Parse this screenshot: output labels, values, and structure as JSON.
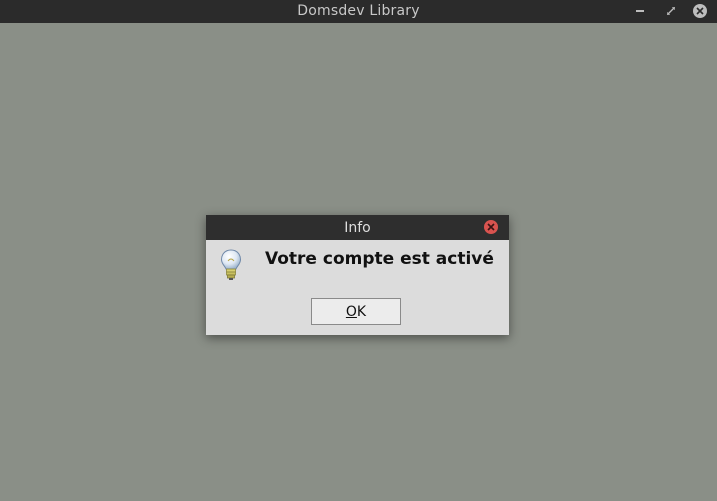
{
  "window": {
    "title": "Domsdev Library",
    "controls": {
      "minimize_icon": "minimize-icon",
      "maximize_icon": "maximize-icon",
      "close_icon": "close-icon"
    },
    "background_color": "#8a8f87"
  },
  "dialog": {
    "title": "Info",
    "icon": "lightbulb-icon",
    "message": "Votre compte est activé",
    "ok_button": {
      "mnemonic": "O",
      "rest": "K"
    },
    "close_color": "#d9534f"
  }
}
